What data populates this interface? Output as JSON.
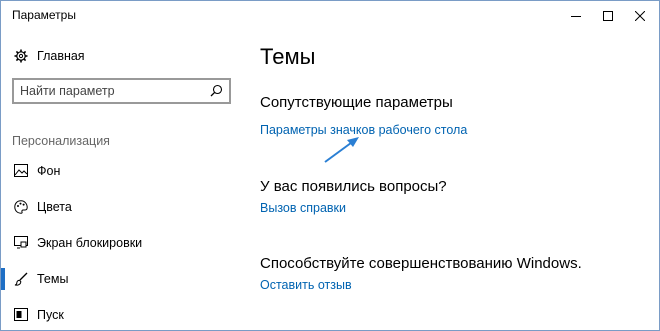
{
  "window": {
    "title": "Параметры",
    "controls": [
      "minimize",
      "maximize",
      "close"
    ]
  },
  "sidebar": {
    "home_label": "Главная",
    "search_placeholder": "Найти параметр",
    "section_header": "Персонализация",
    "items": [
      {
        "label": "Фон",
        "icon": "picture-icon",
        "selected": false
      },
      {
        "label": "Цвета",
        "icon": "palette-icon",
        "selected": false
      },
      {
        "label": "Экран блокировки",
        "icon": "lock-screen-icon",
        "selected": false
      },
      {
        "label": "Темы",
        "icon": "brush-icon",
        "selected": true
      },
      {
        "label": "Пуск",
        "icon": "start-icon",
        "selected": false
      }
    ]
  },
  "main": {
    "title": "Темы",
    "sections": [
      {
        "heading": "Сопутствующие параметры",
        "link": "Параметры значков рабочего стола"
      },
      {
        "heading": "У вас появились вопросы?",
        "link": "Вызов справки"
      },
      {
        "heading": "Способствуйте совершенствованию Windows.",
        "link": "Оставить отзыв"
      }
    ]
  },
  "colors": {
    "accent": "#1f6fc5",
    "link": "#0063b1",
    "annotation_arrow": "#2a7fd4"
  }
}
